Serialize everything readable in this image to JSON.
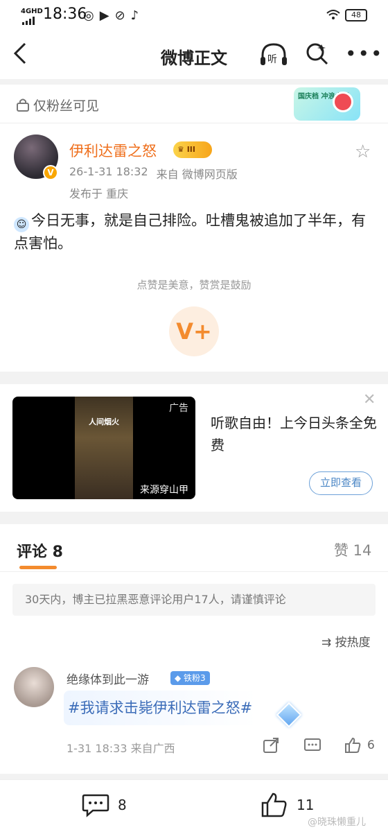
{
  "status_bar": {
    "network": "4GHD",
    "time": "18:36",
    "battery": "48"
  },
  "header": {
    "title": "微博正文",
    "listen_label": "听"
  },
  "visibility": {
    "label": "仅粉丝可见",
    "promo_badge": "国庆档 冲浪大师"
  },
  "post": {
    "author": "伊利达雷之怒",
    "level_badge": "III",
    "date": "26-1-31 18:32",
    "source": "来自 微博网页版",
    "location": "发布于 重庆",
    "text": "今日无事，就是自己排险。吐槽鬼被追加了半年，有点害怕。",
    "reward_hint": "点赞是美意，赞赏是鼓励",
    "reward_icon": "V+"
  },
  "ad": {
    "tag": "广告",
    "source": "来源穿山甲",
    "poster_title": "人间烟火",
    "title": "听歌自由！上今日头条全免费",
    "cta": "立即查看"
  },
  "comments_section": {
    "tab_label": "评论 8",
    "likes_label": "赞 14",
    "notice": "30天内，博主已拉黑恶意评论用户17人，请谨慎评论",
    "sort_label": "按热度",
    "items": [
      {
        "name": "绝缘体到此一游",
        "fan_badge": "铁粉3",
        "text": "#我请求击毙伊利达雷之怒#",
        "meta": "1-31 18:33 来自广西",
        "likes": "6"
      }
    ]
  },
  "bottom_bar": {
    "comments_count": "8",
    "likes_count": "11",
    "watermark": "@晓珠懒重儿"
  }
}
